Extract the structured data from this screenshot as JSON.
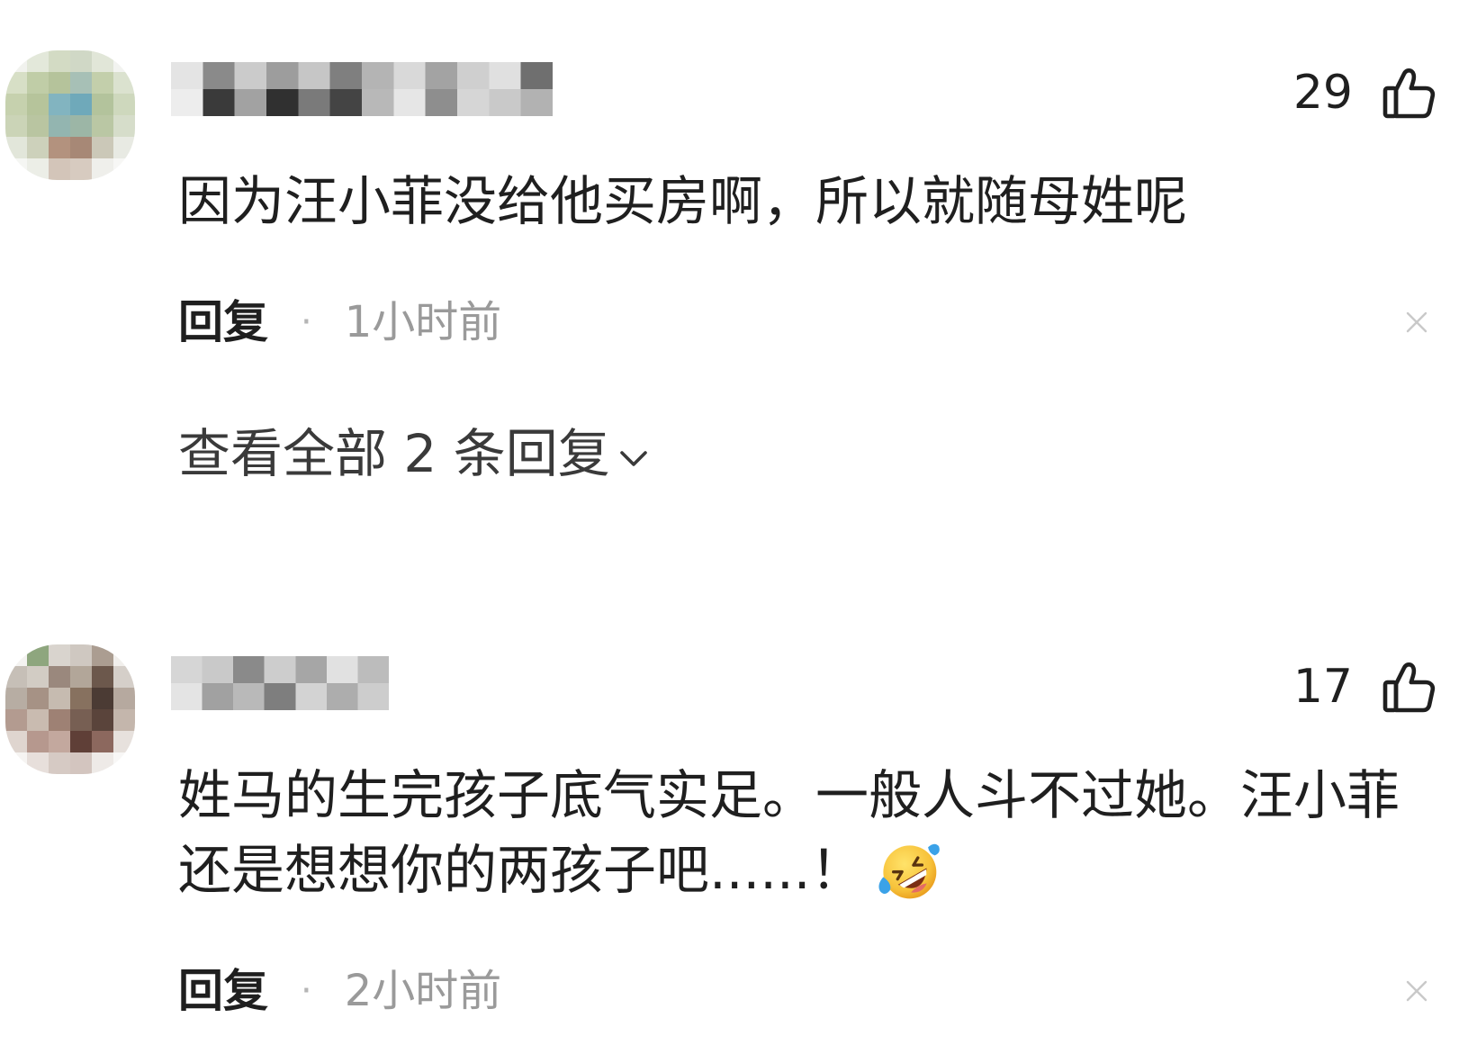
{
  "comments": [
    {
      "likes": "29",
      "like_icon": "thumbs-up-icon",
      "text": "因为汪小菲没给他买房啊，所以就随母姓呢",
      "reply_label": "回复",
      "separator": "·",
      "time": "1小时前",
      "close_icon": "close-icon",
      "view_replies": "查看全部 2 条回复",
      "view_replies_icon": "chevron-down-icon"
    },
    {
      "likes": "17",
      "like_icon": "thumbs-up-icon",
      "text": "姓马的生完孩子底气实足。一般人斗不过她。汪小菲还是想想你的两孩子吧......！",
      "emoji_icon": "laughing-crying-emoji-icon",
      "reply_label": "回复",
      "separator": "·",
      "time": "2小时前",
      "close_icon": "close-icon"
    }
  ],
  "colors": {
    "text_primary": "#1f1f1f",
    "text_secondary": "#9a9a9a",
    "link_text": "#3a3a3a",
    "icon_gray": "#c9c9c9",
    "tear_blue": "#3ba2e8",
    "background": "#ffffff"
  }
}
